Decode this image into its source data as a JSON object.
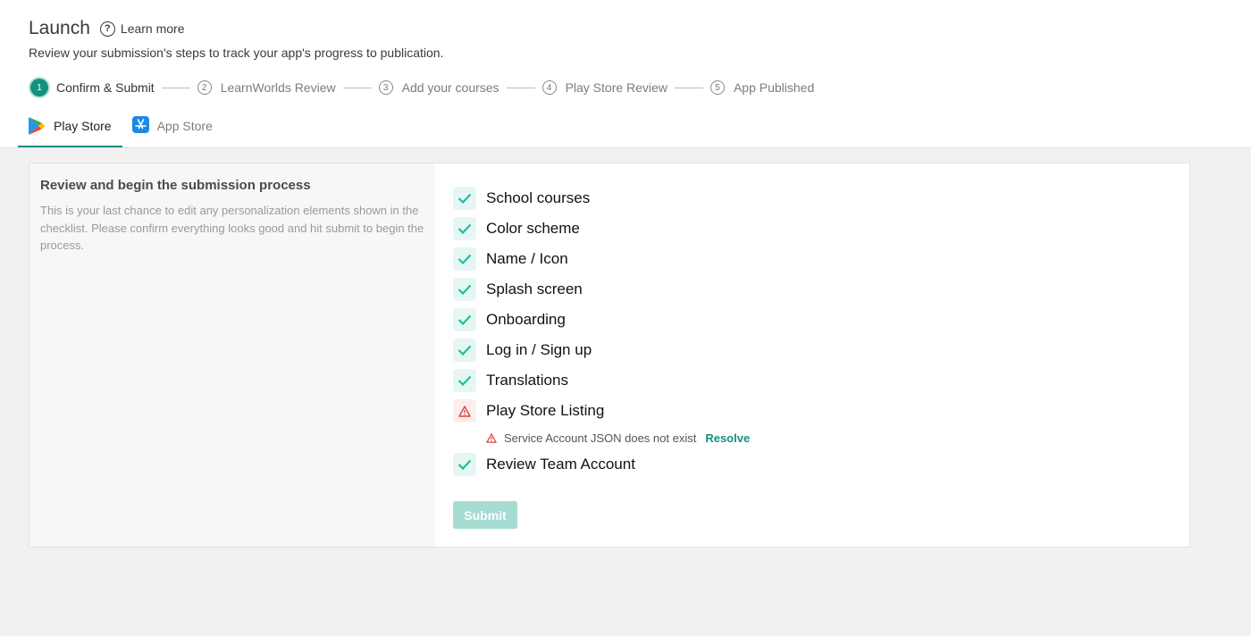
{
  "header": {
    "title": "Launch",
    "learn_more": "Learn more",
    "subtitle": "Review your submission's steps to track your app's progress to publication."
  },
  "steps": [
    {
      "num": "1",
      "label": "Confirm & Submit",
      "active": true
    },
    {
      "num": "2",
      "label": "LearnWorlds Review"
    },
    {
      "num": "3",
      "label": "Add your courses"
    },
    {
      "num": "4",
      "label": "Play Store Review"
    },
    {
      "num": "5",
      "label": "App Published"
    }
  ],
  "tabs": [
    {
      "label": "Play Store",
      "icon": "google-play-icon",
      "active": true
    },
    {
      "label": "App Store",
      "icon": "app-store-icon"
    }
  ],
  "panel": {
    "title": "Review and begin the submission process",
    "description": "This is your last chance to edit any personalization elements shown in the checklist. Please confirm everything looks good and hit submit to begin the process."
  },
  "checklist": [
    {
      "label": "School courses",
      "status": "ok"
    },
    {
      "label": "Color scheme",
      "status": "ok"
    },
    {
      "label": "Name / Icon",
      "status": "ok"
    },
    {
      "label": "Splash screen",
      "status": "ok"
    },
    {
      "label": "Onboarding",
      "status": "ok"
    },
    {
      "label": "Log in / Sign up",
      "status": "ok"
    },
    {
      "label": "Translations",
      "status": "ok"
    },
    {
      "label": "Play Store Listing",
      "status": "warning"
    },
    {
      "label": "Review Team Account",
      "status": "ok"
    }
  ],
  "issue": {
    "text": "Service Account JSON does not exist",
    "action": "Resolve"
  },
  "submit_label": "Submit",
  "colors": {
    "accent": "#14907f",
    "check": "#14c2a3",
    "warning": "#e04545",
    "submit_disabled": "#a6dbd2"
  }
}
